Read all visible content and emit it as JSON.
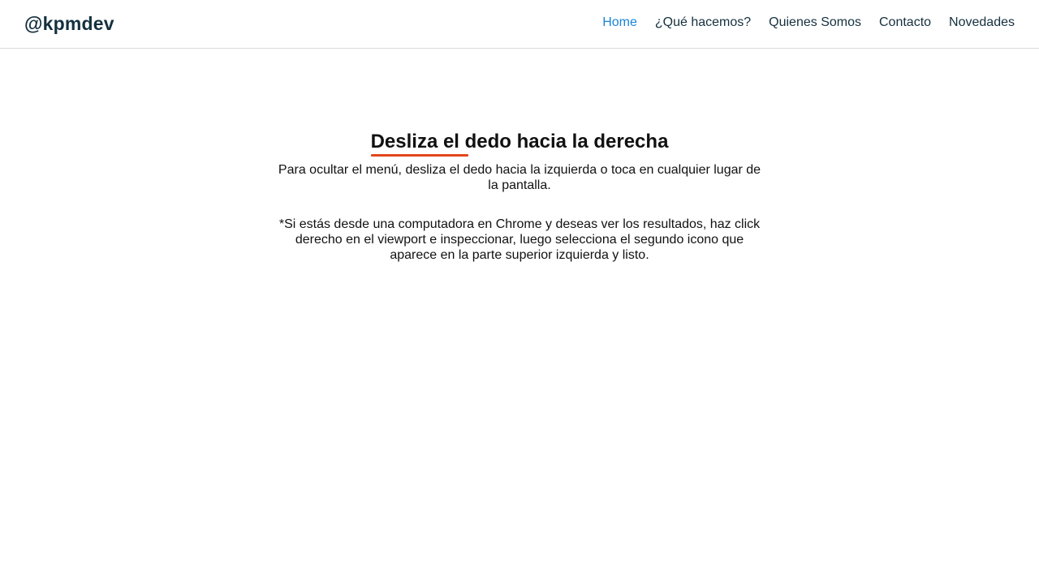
{
  "header": {
    "brand": "@kpmdev",
    "nav": [
      {
        "label": "Home",
        "active": true
      },
      {
        "label": "¿Qué hacemos?",
        "active": false
      },
      {
        "label": "Quienes Somos",
        "active": false
      },
      {
        "label": "Contacto",
        "active": false
      },
      {
        "label": "Novedades",
        "active": false
      }
    ]
  },
  "main": {
    "title": "Desliza el dedo hacia la derecha",
    "paragraph1": "Para ocultar el menú, desliza el dedo hacia la izquierda o toca en cualquier lugar de la pantalla.",
    "paragraph2": "*Si estás desde una computadora en Chrome y deseas ver los resultados, haz click derecho en el viewport e inspeccionar, luego selecciona el segundo icono que aparece en la parte superior izquierda y listo."
  },
  "colors": {
    "active_link": "#1a84d8",
    "brand_text": "#14303f",
    "title_underline": "#e2471c"
  }
}
